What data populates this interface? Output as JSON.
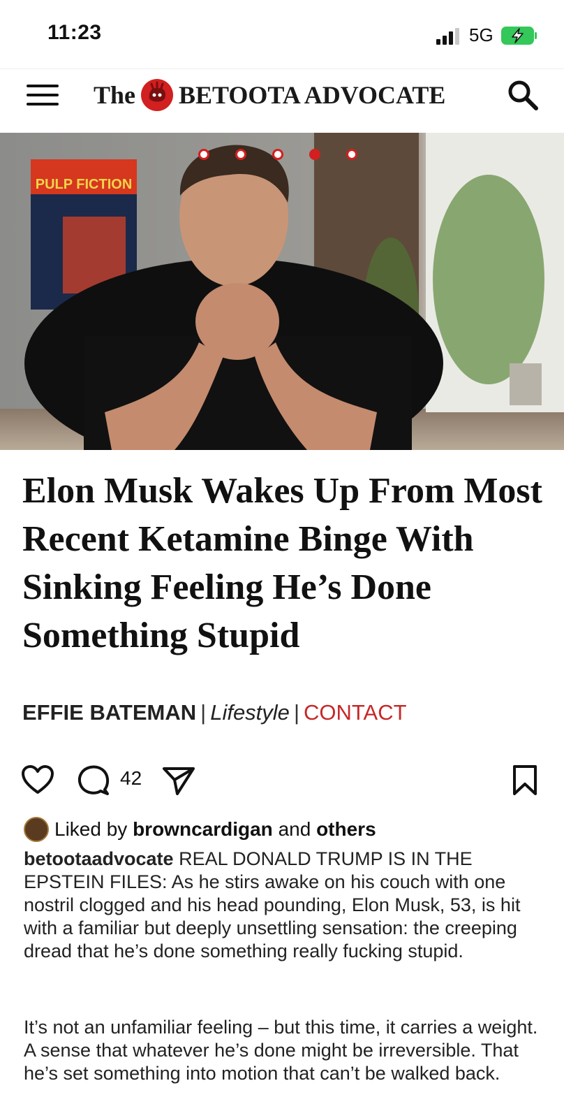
{
  "status_bar": {
    "time": "11:23",
    "network": "5G",
    "signal_icon": "signal-bars-icon",
    "battery_icon": "battery-charging-icon"
  },
  "header": {
    "brand_prefix": "The",
    "brand_name": "BETOOTA ADVOCATE",
    "menu_icon": "hamburger-menu-icon",
    "search_icon": "search-icon",
    "logo": "betoota-logo"
  },
  "hero": {
    "poster_text": "PULP FICTION",
    "slides_total": 5,
    "active_slide": 4
  },
  "article": {
    "headline": "Elon Musk Wakes Up From Most Recent Ketamine Binge With Sinking Feeling He’s Done Something Stupid",
    "author": "EFFIE BATEMAN",
    "category": "Lifestyle",
    "contact": "CONTACT"
  },
  "actions": {
    "like_icon": "heart-icon",
    "comment_icon": "comment-icon",
    "comment_count": "42",
    "share_icon": "send-icon",
    "save_icon": "bookmark-icon"
  },
  "likes": {
    "prefix": "Liked by",
    "user": "browncardigan",
    "middle": "and",
    "others": "others"
  },
  "caption": {
    "handle": "betootaadvocate",
    "text": "REAL DONALD TRUMP IS IN THE EPSTEIN FILES: As he stirs awake on his couch with one nostril clogged and his head pounding, Elon Musk, 53, is hit with a familiar but deeply unsettling sensation: the creeping dread that he’s done something really fucking stupid.",
    "text2": "It’s not an unfamiliar feeling – but this time, it carries a weight. A sense that whatever he’s done might be irreversible. That he’s set something into motion that can’t be walked back."
  },
  "colors": {
    "accent": "#c62828",
    "dot_red": "#d21f1f",
    "text": "#111111"
  }
}
